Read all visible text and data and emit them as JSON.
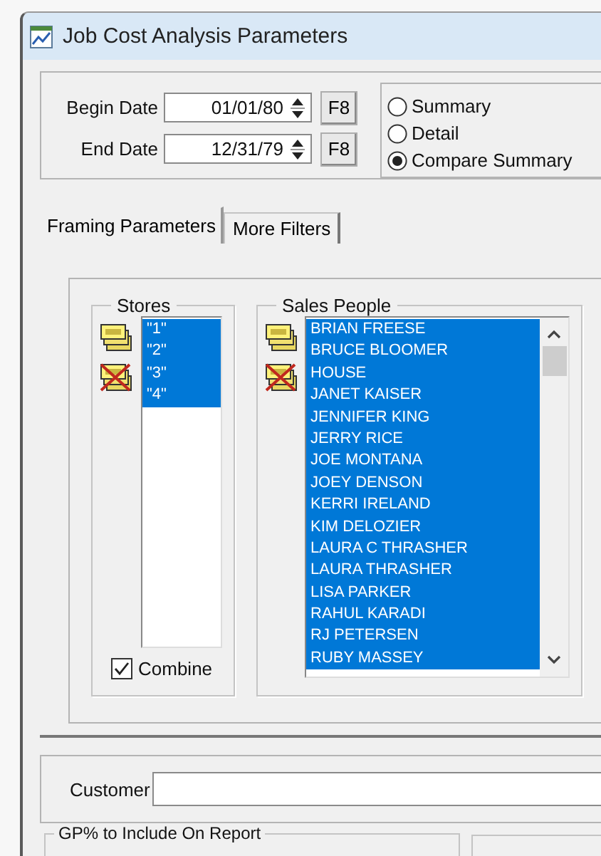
{
  "window": {
    "title": "Job Cost Analysis Parameters"
  },
  "dates": [
    {
      "label": "Begin Date",
      "value": "01/01/80",
      "button": "F8"
    },
    {
      "label": "End Date",
      "value": "12/31/79",
      "button": "F8"
    }
  ],
  "report_type": [
    {
      "label": "Summary",
      "selected": false
    },
    {
      "label": "Detail",
      "selected": false
    },
    {
      "label": "Compare Summary",
      "selected": true
    }
  ],
  "tabs": [
    {
      "label": "Framing Parameters",
      "selected": true
    },
    {
      "label": "More Filters",
      "selected": false
    }
  ],
  "stores": {
    "title": "Stores",
    "items": [
      {
        "label": "\"1\"",
        "selected": true
      },
      {
        "label": "\"2\"",
        "selected": true
      },
      {
        "label": "\"3\"",
        "selected": true
      },
      {
        "label": "\"4\"",
        "selected": true
      }
    ],
    "combine": {
      "label": "Combine",
      "checked": true
    }
  },
  "sales_people": {
    "title": "Sales People",
    "items": [
      {
        "label": "BRIAN FREESE",
        "selected": true
      },
      {
        "label": "BRUCE BLOOMER",
        "selected": true
      },
      {
        "label": "HOUSE",
        "selected": true
      },
      {
        "label": "JANET KAISER",
        "selected": true
      },
      {
        "label": "JENNIFER KING",
        "selected": true
      },
      {
        "label": "JERRY RICE",
        "selected": true
      },
      {
        "label": "JOE MONTANA",
        "selected": true
      },
      {
        "label": "JOEY DENSON",
        "selected": true
      },
      {
        "label": "KERRI IRELAND",
        "selected": true
      },
      {
        "label": "KIM DELOZIER",
        "selected": true
      },
      {
        "label": "LAURA C THRASHER",
        "selected": true
      },
      {
        "label": "LAURA THRASHER",
        "selected": true
      },
      {
        "label": "LISA PARKER",
        "selected": true
      },
      {
        "label": "RAHUL KARADI",
        "selected": true
      },
      {
        "label": "RJ PETERSEN",
        "selected": true
      },
      {
        "label": "RUBY MASSEY",
        "selected": true
      }
    ]
  },
  "customer": {
    "label": "Customer"
  },
  "gp_group": {
    "title": "GP% to Include On Report"
  }
}
